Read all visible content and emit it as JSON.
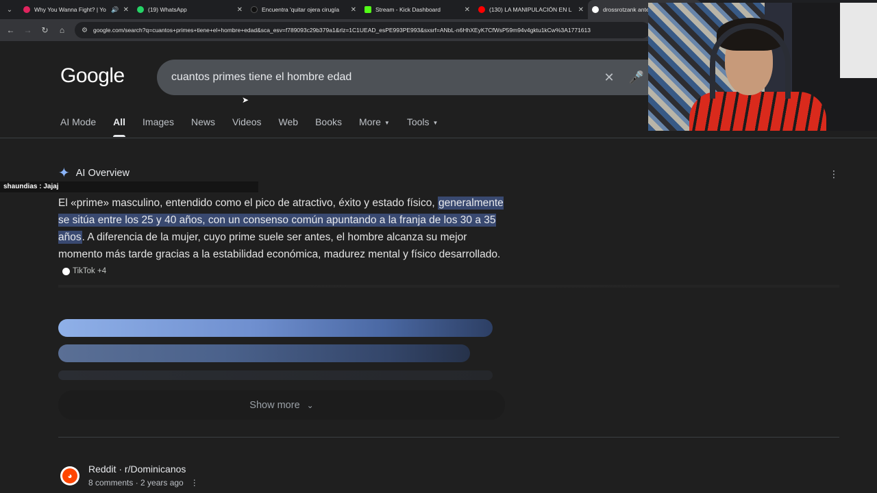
{
  "browser": {
    "tabs": [
      {
        "title": "Why You Wanna Fight? | Yo",
        "favicon_color": "#e0245e",
        "audio": true,
        "active": false
      },
      {
        "title": "(19) WhatsApp",
        "favicon_color": "#25d366",
        "active": false
      },
      {
        "title": "Encuentra 'quitar ojera cirugía",
        "favicon_color": "#111111",
        "active": false
      },
      {
        "title": "Stream - Kick Dashboard",
        "favicon_color": "#53fc18",
        "active": false
      },
      {
        "title": "(130) LA MANIPULACIÓN EN L",
        "favicon_color": "#ff0000",
        "active": false
      },
      {
        "title": "drossrotzank antes - G",
        "favicon_color": "#ffffff",
        "active": true
      }
    ],
    "url": "google.com/search?q=cuantos+primes+tiene+el+hombre+edad&sca_esv=f789093c29b379a1&rlz=1C1UEAD_esPE993PE993&sxsrf=ANbL-n6HhXEyK7CfWsP59m94v4gktu1kCw%3A1771613"
  },
  "google": {
    "logo": "Google",
    "query": "cuantos primes tiene el hombre edad",
    "tabs": [
      "AI Mode",
      "All",
      "Images",
      "News",
      "Videos",
      "Web",
      "Books",
      "More",
      "Tools"
    ],
    "active_tab": "All"
  },
  "ai_overview": {
    "heading": "AI Overview",
    "text_before": "El «prime» masculino, entendido como el pico de atractivo, éxito y estado físico, ",
    "highlight": "generalmente se sitúa entre los 25 y 40 años, con un consenso común apuntando a la franja de los 30 a 35 años",
    "text_after": ". A diferencia de la mujer, cuyo prime suele ser antes, el hombre alcanza su mejor momento más tarde gracias a la estabilidad económica, madurez mental y físico desarrollado.",
    "source_chip": "TikTok +4",
    "show_more": "Show more"
  },
  "chat_overlay": "shaundias : Jajaj",
  "result": {
    "site": "Reddit · r/Dominicanos",
    "meta": "8 comments · 2 years ago"
  }
}
